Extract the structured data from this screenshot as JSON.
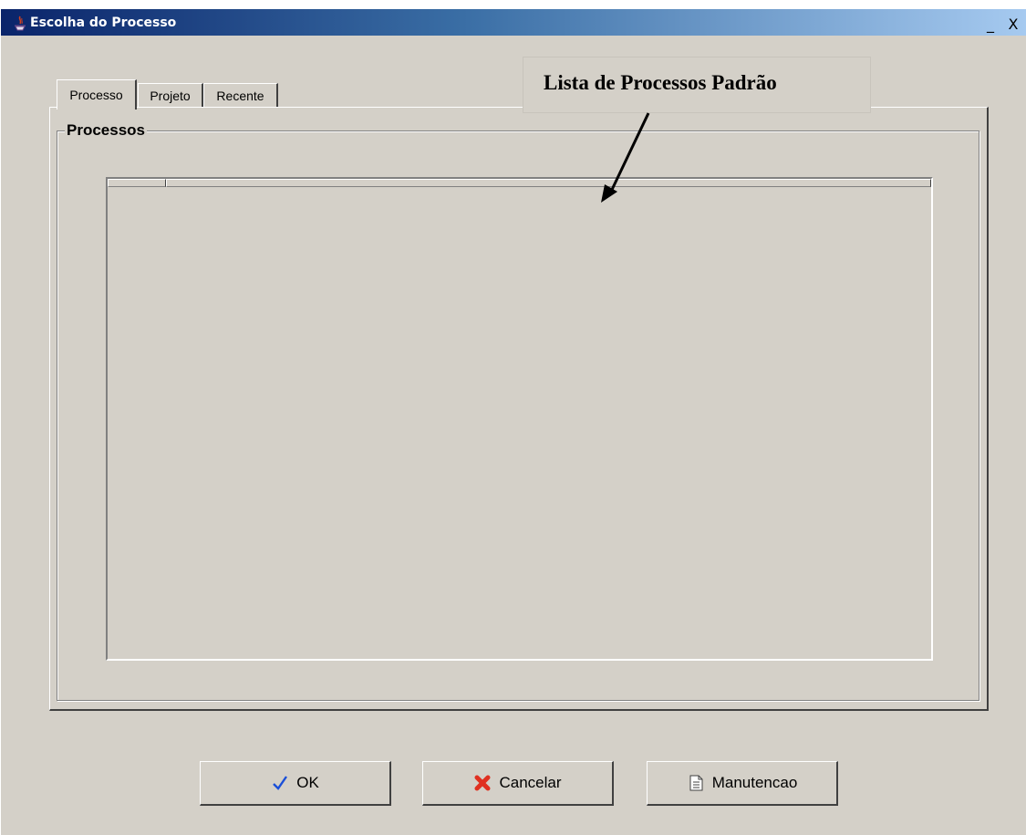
{
  "window": {
    "title": "Escolha do Processo",
    "minimize_symbol": "_",
    "close_symbol": "X"
  },
  "tabs": [
    {
      "label": "Processo",
      "active": true
    },
    {
      "label": "Projeto",
      "active": false
    },
    {
      "label": "Recente",
      "active": false
    }
  ],
  "group": {
    "title": "Processos"
  },
  "annotation": {
    "text": "Lista de Processos Padrão"
  },
  "buttons": {
    "ok": {
      "label": "OK",
      "icon": "checkmark-icon"
    },
    "cancel": {
      "label": "Cancelar",
      "icon": "red-x-icon"
    },
    "maintenance": {
      "label": "Manutencao",
      "icon": "document-icon"
    }
  },
  "colors": {
    "background": "#d4d0c8",
    "titlebar_start": "#0a246a",
    "titlebar_end": "#a6caf0",
    "check": "#1a4fd8",
    "cancel_x": "#e03020"
  }
}
